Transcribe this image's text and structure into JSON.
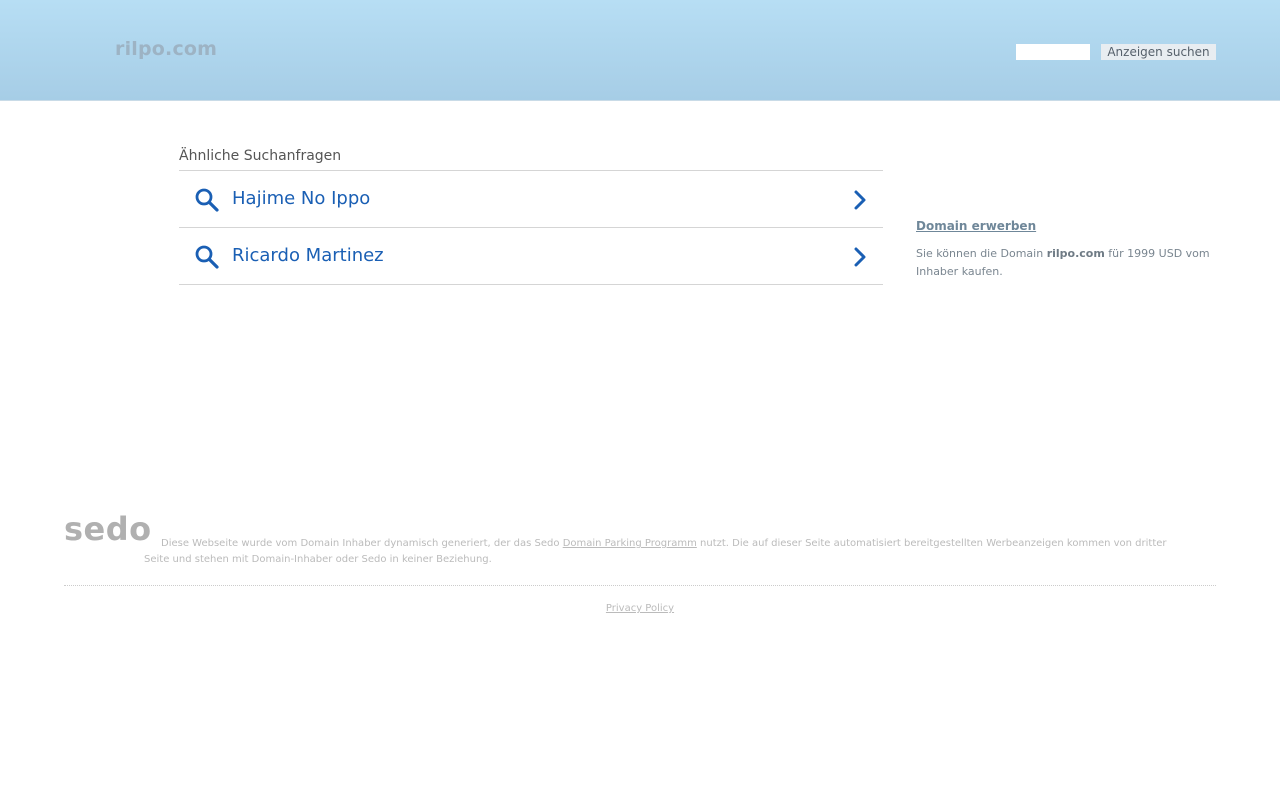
{
  "header": {
    "domain": "rilpo.com",
    "search_placeholder": "",
    "search_button_label": "Anzeigen suchen"
  },
  "related": {
    "heading": "Ähnliche Suchanfragen",
    "items": [
      {
        "label": "Hajime No Ippo",
        "icon": "search-icon",
        "action_icon": "chevron-right-icon"
      },
      {
        "label": "Ricardo Martinez",
        "icon": "search-icon",
        "action_icon": "chevron-right-icon"
      }
    ]
  },
  "buy": {
    "link_label": "Domain erwerben",
    "text_before": "Sie können die Domain ",
    "domain": "rilpo.com",
    "text_after": " für 1999 USD vom Inhaber kaufen."
  },
  "footer": {
    "logo": "sedo",
    "disclaimer_before": "Diese Webseite wurde vom Domain Inhaber dynamisch generiert, der das Sedo ",
    "disclaimer_link": "Domain Parking Programm",
    "disclaimer_after": " nutzt. Die auf dieser Seite automatisiert bereitgestellten Werbeanzeigen kommen von dritter Seite und stehen mit Domain-Inhaber oder Sedo in keiner Beziehung.",
    "privacy_label": "Privacy Policy"
  },
  "colors": {
    "header_gradient_top": "#b7def4",
    "header_gradient_bottom": "#a6cde6",
    "link_blue": "#1a5fb4",
    "muted_text": "#bbbbbb"
  }
}
